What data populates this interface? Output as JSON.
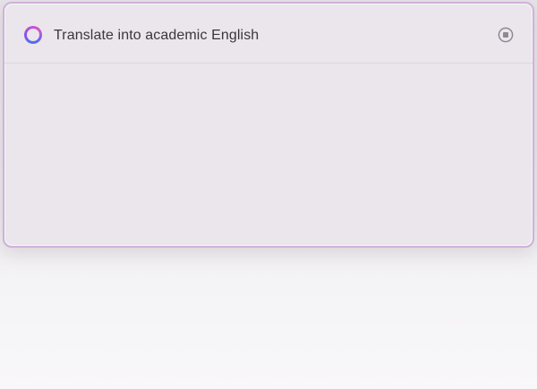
{
  "panel": {
    "prompt_text": "Translate into academic English",
    "status_icon": "loading-ring-icon",
    "stop_icon": "stop-circle-icon",
    "output_text": ""
  },
  "colors": {
    "panel_border": "#cfb2d9",
    "panel_background": "#ebe6ec",
    "ring_gradient": [
      "#4f6cf2",
      "#8a55e8",
      "#c04fd6"
    ],
    "text": "#3a373c"
  }
}
